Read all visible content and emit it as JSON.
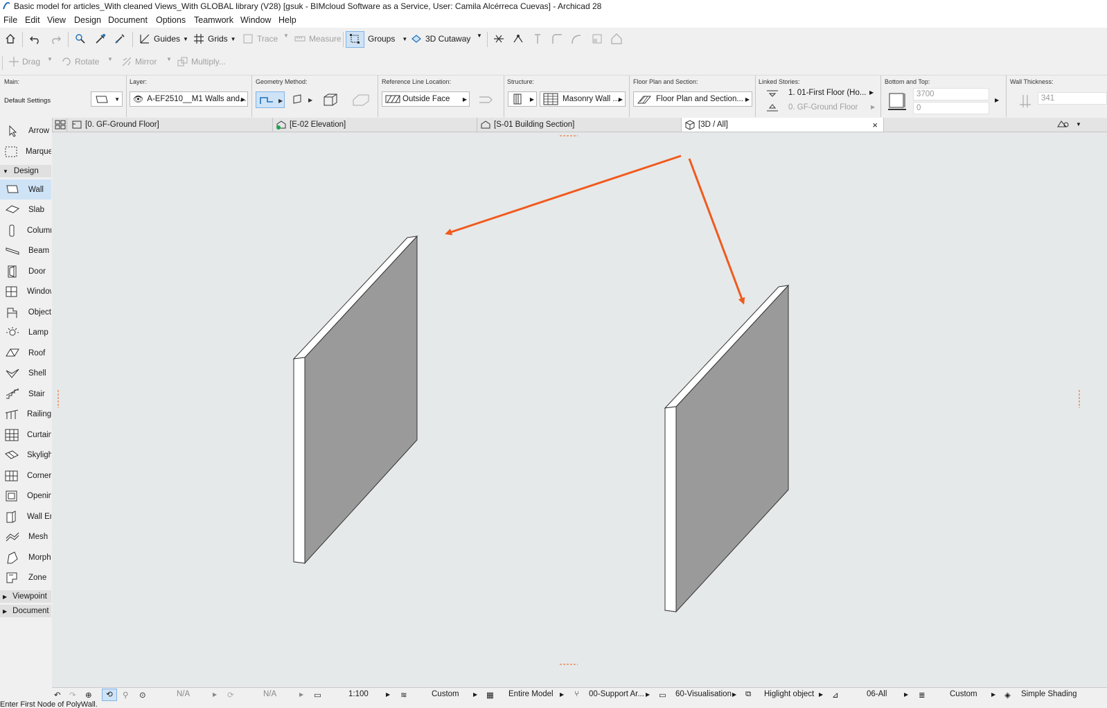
{
  "window": {
    "title": "Basic model for articles_With cleaned Views_With GLOBAL library (V28) [gsuk - BIMcloud Software as a Service, User: Camila Alcérreca Cuevas] - Archicad 28"
  },
  "menu": [
    "File",
    "Edit",
    "View",
    "Design",
    "Document",
    "Options",
    "Teamwork",
    "Window",
    "Help"
  ],
  "toolbar1": {
    "guides": "Guides",
    "grids": "Grids",
    "trace": "Trace",
    "measure": "Measure",
    "groups": "Groups",
    "cutaway": "3D Cutaway"
  },
  "toolbar2": {
    "drag": "Drag",
    "rotate": "Rotate",
    "mirror": "Mirror",
    "multiply": "Multiply..."
  },
  "infobox": {
    "main_label": "Main:",
    "main_value": "Default Settings",
    "layer_label": "Layer:",
    "layer_value": "A-EF2510__M1 Walls and...",
    "geometry_label": "Geometry Method:",
    "refline_label": "Reference Line Location:",
    "refline_value": "Outside Face",
    "structure_label": "Structure:",
    "structure_value": "Masonry Wall ...",
    "fps_label": "Floor Plan and Section:",
    "fps_value": "Floor Plan and Section...",
    "linked_label": "Linked Stories:",
    "linked_top": "1. 01-First Floor (Ho...",
    "linked_bottom": "0. GF-Ground Floor",
    "bt_label": "Bottom and Top:",
    "top_value": "3700",
    "bottom_value": "0",
    "thick_label": "Wall Thickness:",
    "thick_value": "341"
  },
  "tabs": [
    {
      "label": "[0. GF-Ground Floor]"
    },
    {
      "label": "[E-02 Elevation]"
    },
    {
      "label": "[S-01 Building Section]"
    },
    {
      "label": "[3D / All]",
      "close": "×"
    }
  ],
  "toolbox": {
    "top": [
      "Arrow",
      "Marquee"
    ],
    "design_label": "Design",
    "design": [
      "Wall",
      "Slab",
      "Column",
      "Beam",
      "Door",
      "Window",
      "Object",
      "Lamp",
      "Roof",
      "Shell",
      "Stair",
      "Railing",
      "Curtain Wall",
      "Skylight",
      "Corner Window",
      "Opening",
      "Wall End",
      "Mesh",
      "Morph",
      "Zone"
    ],
    "viewpoint_label": "Viewpoint",
    "document_label": "Document"
  },
  "statusbar": {
    "zoom": "N/A",
    "angle": "N/A",
    "scale": "1:100",
    "pen": "Custom",
    "model": "Entire Model",
    "layers": "00-Support Ar...",
    "view": "60-Visualisation",
    "override": "Higlight object",
    "dim": "06-All",
    "render": "Custom",
    "shading": "Simple Shading"
  },
  "hint": "Enter First Node of PolyWall.",
  "colors": {
    "arrow": "#f05a1c",
    "wall_face": "#9a9a9a",
    "wall_edge": "#ffffff",
    "viewport_bg": "#e6e9ea",
    "selection": "#cfe3f7"
  }
}
